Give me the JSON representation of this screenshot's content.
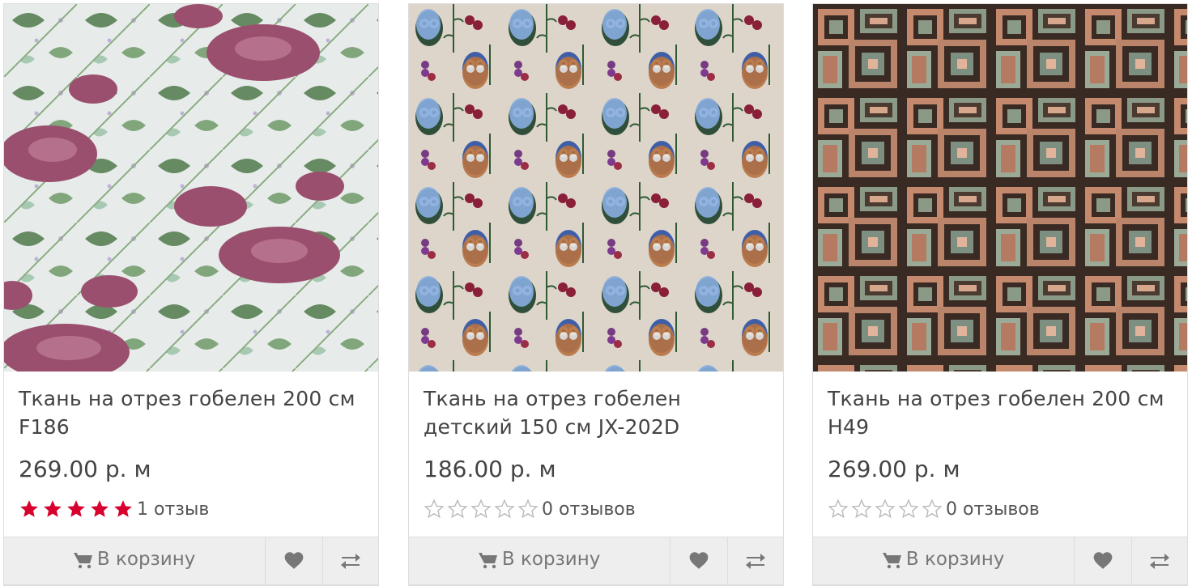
{
  "products": [
    {
      "name_line1": "Ткань на отрез гобелен 200 см",
      "name_line2": "F186",
      "price": "269.00 р. м",
      "rating": 5,
      "reviews": "1 отзыв",
      "image_icon": "floral-tapestry-image",
      "cart_label": "В корзину"
    },
    {
      "name_line1": "Ткань на отрез гобелен",
      "name_line2": "детский 150 см JX-202D",
      "price": "186.00 р. м",
      "rating": 0,
      "reviews": "0 отзывов",
      "image_icon": "owl-tapestry-image",
      "cart_label": "В корзину"
    },
    {
      "name_line1": "Ткань на отрез гобелен 200 см",
      "name_line2": "H49",
      "price": "269.00 р. м",
      "rating": 0,
      "reviews": "0 отзывов",
      "image_icon": "geometric-tapestry-image",
      "cart_label": "В корзину"
    }
  ],
  "colors": {
    "star_filled": "#d8002e",
    "star_empty": "#bbbbbb",
    "text": "#444444",
    "button_bg": "#eeeeee"
  }
}
